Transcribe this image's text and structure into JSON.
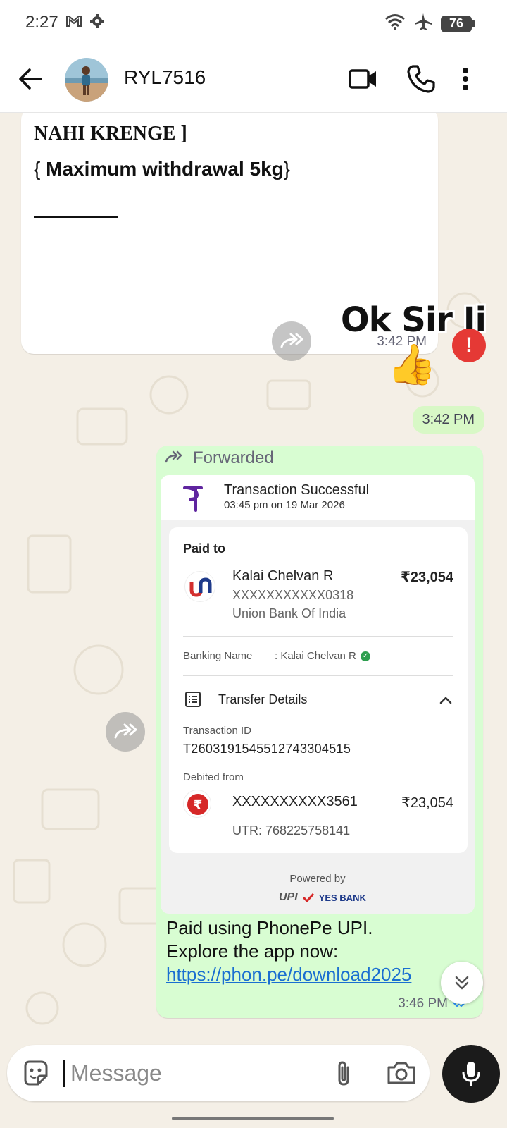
{
  "status_bar": {
    "time": "2:27",
    "battery": "76"
  },
  "header": {
    "contact_name": "RYL7516"
  },
  "messages": {
    "incoming": {
      "line1": "NAHI KRENGE ]",
      "line2_open": "{ ",
      "line2_bold": "Maximum withdrawal 5kg",
      "line2_close": "}",
      "time": "3:42 PM"
    },
    "sticker": {
      "text": "Ok Sir Ji",
      "emoji": "👍",
      "error_mark": "!",
      "time": "3:42 PM"
    },
    "forwarded": {
      "label": "Forwarded",
      "receipt": {
        "title": "Transaction Successful",
        "subtitle": "03:45 pm on 19 Mar 2026",
        "paid_to_label": "Paid to",
        "payee_name": "Kalai Chelvan R",
        "payee_account": "XXXXXXXXXXX0318",
        "payee_bank": "Union Bank Of India",
        "amount": "₹23,054",
        "banking_name_label": "Banking Name",
        "banking_name_value": ": Kalai Chelvan R",
        "transfer_details_label": "Transfer Details",
        "transaction_id_label": "Transaction ID",
        "transaction_id": "T2603191545512743304515",
        "debited_from_label": "Debited from",
        "debit_account": "XXXXXXXXXX3561",
        "debit_amount": "₹23,054",
        "utr": "UTR: 768225758141",
        "powered_by": "Powered by",
        "upi_text": "UPI",
        "yes_bank_text": "YES BANK"
      },
      "text_line1": "Paid using PhonePe UPI.",
      "text_line2": "Explore the app now:",
      "link": "https://phon.pe/download2025",
      "time": "3:46 PM"
    }
  },
  "composer": {
    "placeholder": "Message"
  },
  "colors": {
    "outgoing_bubble": "#d8fdd2",
    "incoming_bubble": "#ffffff",
    "link": "#1a6fd1",
    "error": "#e53935",
    "tick": "#2a8ff7"
  }
}
